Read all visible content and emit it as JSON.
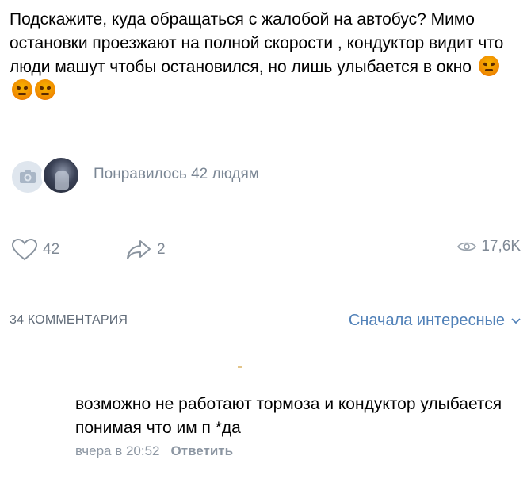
{
  "post": {
    "text": "Подскажите, куда обращаться с жалобой на автобус? Мимо остановки проезжают на полной скорости , кондуктор видит что люди машут чтобы остановился, но лишь улыбается в окно",
    "emojis": [
      "angry-face-icon",
      "angry-face-icon",
      "angry-face-icon"
    ]
  },
  "likes_summary": {
    "text": "Понравилось 42 людям"
  },
  "actions": {
    "like_count": "42",
    "share_count": "2",
    "views_count": "17,6K"
  },
  "comments_header": {
    "count_label": "34 КОММЕНТАРИЯ",
    "sort_label": "Сначала интересные"
  },
  "comment": {
    "text": "возможно не работают тормоза и кондуктор улыбается понимая что им п *да",
    "time": "вчера в 20:52",
    "reply_label": "Ответить"
  },
  "colors": {
    "accent": "#5181b8",
    "muted": "#7f8995",
    "text": "#000000"
  }
}
